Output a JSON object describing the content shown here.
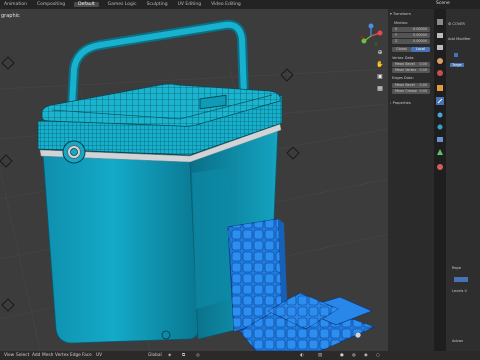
{
  "topbar": {
    "tabs": [
      "Animation",
      "Compositing",
      "Default",
      "Games Logic",
      "Sculpting",
      "UV Editing",
      "Video Editing"
    ],
    "active_tab": "Default",
    "scene_label": "Scene"
  },
  "viewport": {
    "label": "graphic"
  },
  "npanel": {
    "transform_header": "Transform",
    "median_label": "Median:",
    "fields": [
      {
        "axis": "X",
        "value": "0.00000"
      },
      {
        "axis": "Y",
        "value": "0.00000"
      },
      {
        "axis": "Z",
        "value": "0.00000"
      }
    ],
    "global_label": "Global",
    "local_label": "Local",
    "vertex_data_label": "Vertex Data:",
    "mean_bevel_label": "Mean Bevel",
    "mean_bevel_value": "0.00",
    "mean_vertex_label": "Mean Vertex",
    "mean_vertex_value": "0.00",
    "edges_data_label": "Edges Data:",
    "mean_bevel2_label": "Mean Bevel",
    "mean_bevel2_value": "0.00",
    "mean_crease_label": "Mean Crease",
    "mean_crease_value": "0.00",
    "properties_header": "Properties"
  },
  "props": {
    "object_name": "COVER",
    "add_modifier": "Add Modifier",
    "label_3": "Targe",
    "label_4": "Repe",
    "label_5": "Levels V",
    "label_6": "Advan"
  },
  "bottombar": {
    "items": [
      "View",
      "Select",
      "Add",
      "Mesh",
      "Vertex",
      "Edge",
      "Face",
      "UV"
    ],
    "orientation": "Global"
  },
  "colors": {
    "cyan_main": "#12a8c4",
    "cyan_dark": "#0b7f98",
    "ice_blue": "#1f7ae0",
    "accent_blue": "#4772b3"
  }
}
